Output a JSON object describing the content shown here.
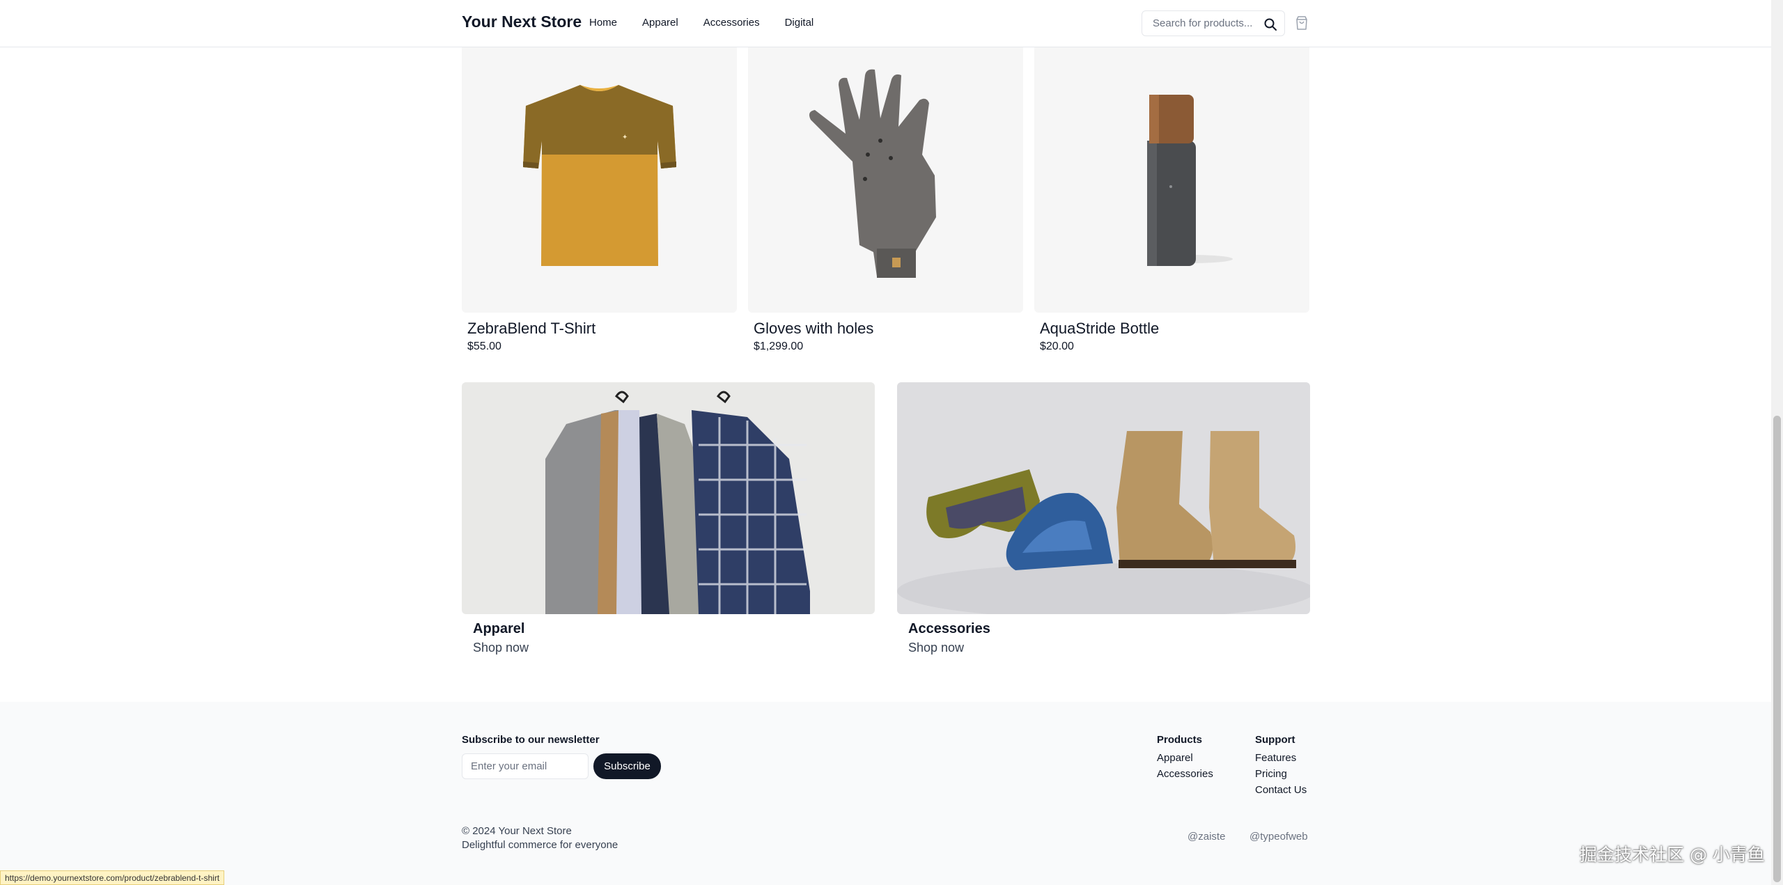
{
  "header": {
    "brand": "Your Next Store",
    "nav": [
      "Home",
      "Apparel",
      "Accessories",
      "Digital"
    ],
    "search_placeholder": "Search for products..."
  },
  "products": [
    {
      "name": "ZebraBlend T-Shirt",
      "price": "$55.00"
    },
    {
      "name": "Gloves with holes",
      "price": "$1,299.00"
    },
    {
      "name": "AquaStride Bottle",
      "price": "$20.00"
    }
  ],
  "categories": [
    {
      "title": "Apparel",
      "cta": "Shop now"
    },
    {
      "title": "Accessories",
      "cta": "Shop now"
    }
  ],
  "footer": {
    "newsletter_title": "Subscribe to our newsletter",
    "email_placeholder": "Enter your email",
    "subscribe_label": "Subscribe",
    "products_heading": "Products",
    "products_links": [
      "Apparel",
      "Accessories"
    ],
    "support_heading": "Support",
    "support_links": [
      "Features",
      "Pricing",
      "Contact Us"
    ],
    "copyright": "© 2024 Your Next Store",
    "tagline": "Delightful commerce for everyone",
    "social": [
      "@zaiste",
      "@typeofweb"
    ]
  },
  "status_url": "https://demo.yournextstore.com/product/zebrablend-t-shirt",
  "watermark": "掘金技术社区 @ 小青鱼"
}
